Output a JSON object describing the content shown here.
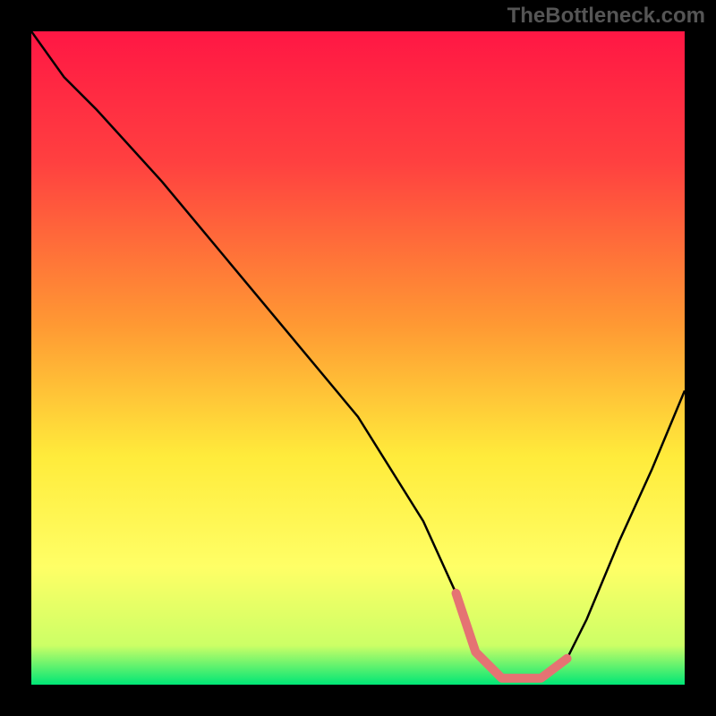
{
  "watermark": "TheBottleneck.com",
  "chart_data": {
    "type": "line",
    "title": "",
    "xlabel": "",
    "ylabel": "",
    "xlim": [
      0,
      100
    ],
    "ylim": [
      0,
      100
    ],
    "gradient_stops": [
      {
        "offset": 0,
        "color": "#ff1744"
      },
      {
        "offset": 20,
        "color": "#ff4040"
      },
      {
        "offset": 45,
        "color": "#ff9933"
      },
      {
        "offset": 65,
        "color": "#ffeb3b"
      },
      {
        "offset": 82,
        "color": "#ffff66"
      },
      {
        "offset": 94,
        "color": "#ccff66"
      },
      {
        "offset": 100,
        "color": "#00e676"
      }
    ],
    "series": [
      {
        "name": "bottleneck-curve",
        "x": [
          0,
          5,
          10,
          20,
          30,
          40,
          50,
          60,
          65,
          68,
          72,
          78,
          82,
          85,
          90,
          95,
          100
        ],
        "y": [
          100,
          93,
          88,
          77,
          65,
          53,
          41,
          25,
          14,
          5,
          1,
          1,
          4,
          10,
          22,
          33,
          45
        ]
      }
    ],
    "highlight_segment": {
      "name": "highlighted-range",
      "color": "#e57373",
      "x": [
        65,
        68,
        72,
        78,
        82
      ],
      "y": [
        14,
        5,
        1,
        1,
        4
      ]
    }
  }
}
